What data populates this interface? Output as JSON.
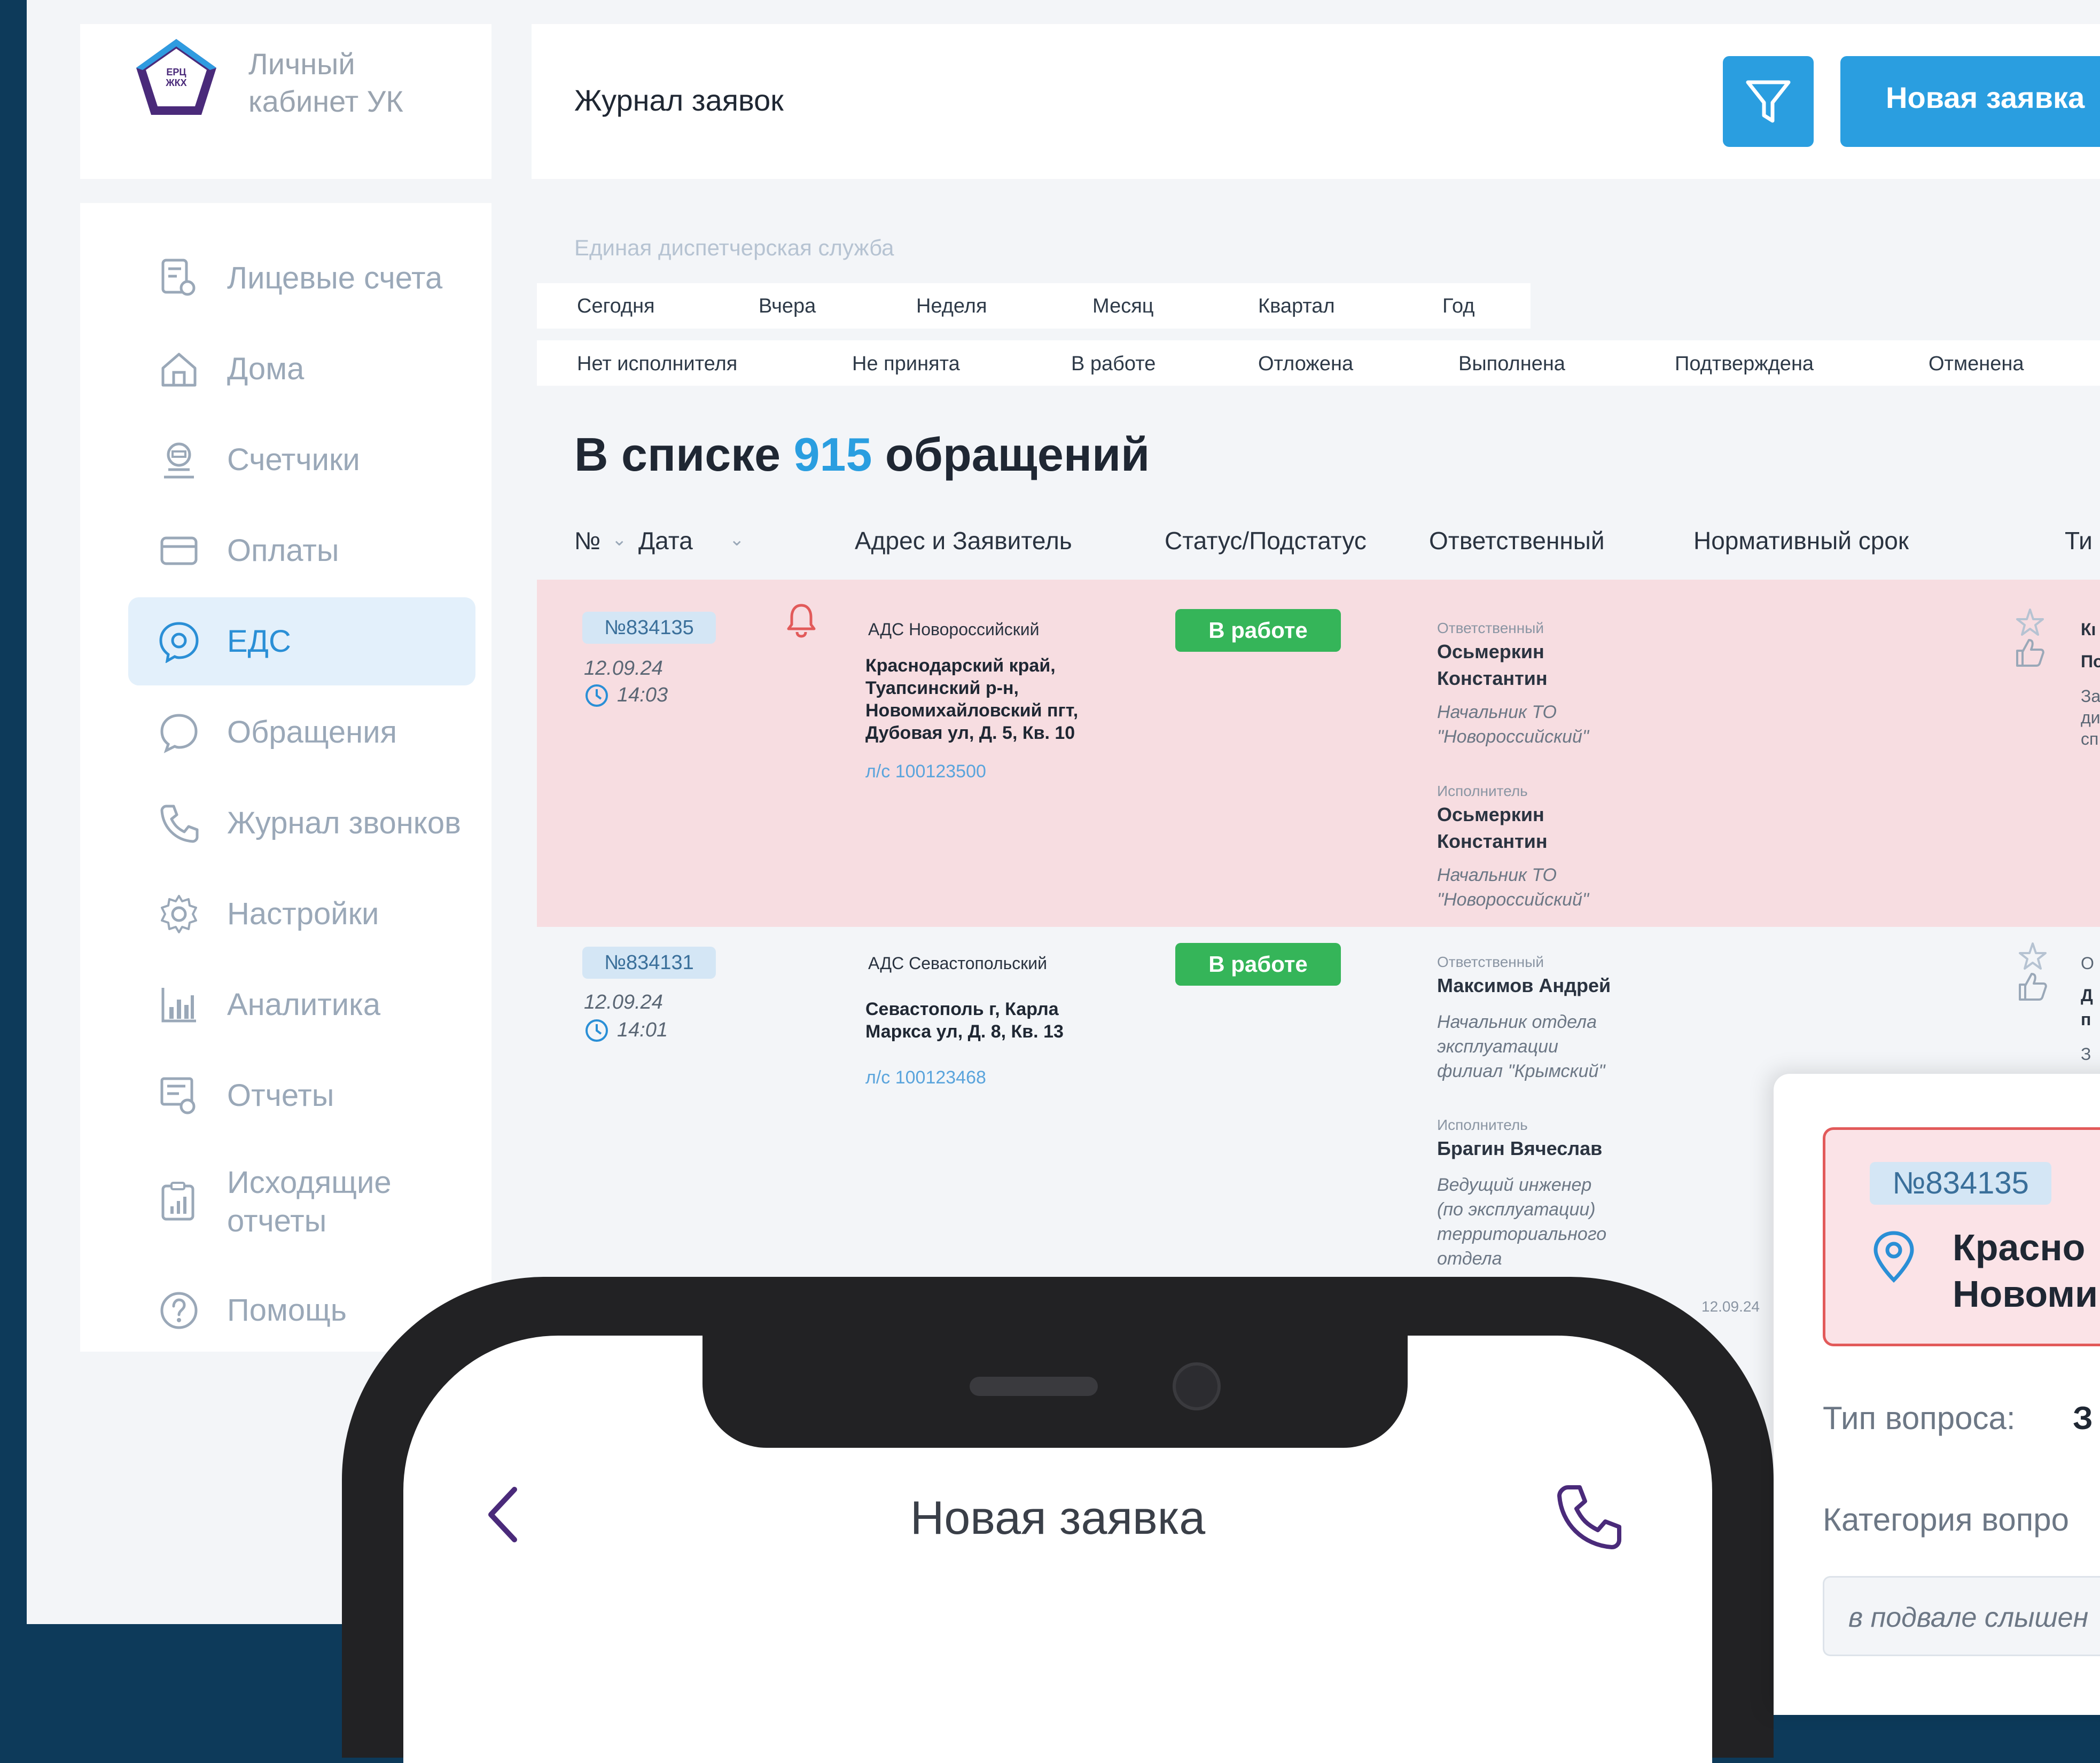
{
  "app": {
    "logo_badge": "ЕРЦ ЖКХ",
    "logo_line1": "Личный",
    "logo_line2": "кабинет УК",
    "colors": {
      "accent": "#2a9ee0",
      "highlight_row": "#f7dde1",
      "status_green": "#35b559",
      "background": "#0d3a5a"
    }
  },
  "sidebar": {
    "items": [
      {
        "label": "Лицевые счета",
        "icon": "personal-accounts-icon"
      },
      {
        "label": "Дома",
        "icon": "house-icon"
      },
      {
        "label": "Счетчики",
        "icon": "meter-icon"
      },
      {
        "label": "Оплаты",
        "icon": "card-icon"
      },
      {
        "label": "ЕДС",
        "icon": "eds-icon",
        "active": true
      },
      {
        "label": "Обращения",
        "icon": "chat-icon"
      },
      {
        "label": "Журнал звонков",
        "icon": "phone-icon"
      },
      {
        "label": "Настройки",
        "icon": "gear-icon"
      },
      {
        "label": "Аналитика",
        "icon": "analytics-icon"
      },
      {
        "label": "Отчеты",
        "icon": "reports-icon"
      },
      {
        "label": "Исходящие",
        "label2": "отчеты",
        "icon": "outgoing-reports-icon"
      },
      {
        "label": "Помощь",
        "icon": "help-icon"
      }
    ]
  },
  "header": {
    "title": "Журнал заявок",
    "new_request_label": "Новая заявка"
  },
  "filters": {
    "service_label": "Единая диспетчерская служба",
    "periods": [
      "Сегодня",
      "Вчера",
      "Неделя",
      "Месяц",
      "Квартал",
      "Год"
    ],
    "statuses": [
      "Нет исполнителя",
      "Не принята",
      "В работе",
      "Отложена",
      "Выполнена",
      "Подтверждена",
      "Отменена"
    ]
  },
  "summary": {
    "prefix": "В списке",
    "count": "915",
    "suffix": "обращений"
  },
  "table": {
    "columns": [
      "№",
      "Дата",
      "Адрес и Заявитель",
      "Статус/Подстатус",
      "Ответственный",
      "Нормативный срок",
      "Ти"
    ],
    "rows": [
      {
        "number": "№834135",
        "date": "12.09.24",
        "time": "14:03",
        "ads": "АДС Новороссийский",
        "address": [
          "Краснодарский край,",
          "Туапсинский р-н,",
          "Новомихайловский пгт,",
          "Дубовая ул, Д. 5, Кв. 10"
        ],
        "account": "л/с 100123500",
        "status": "В работе",
        "responsible_label": "Ответственный",
        "responsible_name": [
          "Осьмеркин",
          "Константин"
        ],
        "responsible_pos": [
          "Начальник ТО",
          "\"Новороссийский\""
        ],
        "executor_label": "Исполнитель",
        "executor_name": [
          "Осьмеркин",
          "Константин"
        ],
        "executor_pos": [
          "Начальник ТО",
          "\"Новороссийский\""
        ],
        "type_cut": [
          "Кı",
          "По",
          "За",
          "ди",
          "сп"
        ]
      },
      {
        "number": "№834131",
        "date": "12.09.24",
        "time": "14:01",
        "ads": "АДС Севастопольский",
        "address": [
          "Севастополь г, Карла",
          "Маркса ул, Д. 8, Кв. 13"
        ],
        "account": "л/с 100123468",
        "status": "В работе",
        "responsible_label": "Ответственный",
        "responsible_name": [
          "Максимов Андрей"
        ],
        "responsible_pos": [
          "Начальник отдела",
          "эксплуатации",
          "филиал \"Крымский\""
        ],
        "executor_label": "Исполнитель",
        "executor_name": [
          "Брагин Вячеслав"
        ],
        "executor_pos": [
          "Ведущий инженер",
          "(по эксплуатации)",
          "территориального",
          "отдела"
        ],
        "type_cut": [
          "О",
          "Д",
          "п",
          "З"
        ]
      }
    ],
    "third_row_date": "12.09.24"
  },
  "popup": {
    "number": "№834135",
    "address_line1": "Красно",
    "address_line2": "Новоми",
    "question_type_label": "Тип вопроса:",
    "question_type_value": "З",
    "category_label": "Категория вопро",
    "input_value": "в подвале слышен"
  },
  "phone": {
    "title": "Новая заявка"
  }
}
